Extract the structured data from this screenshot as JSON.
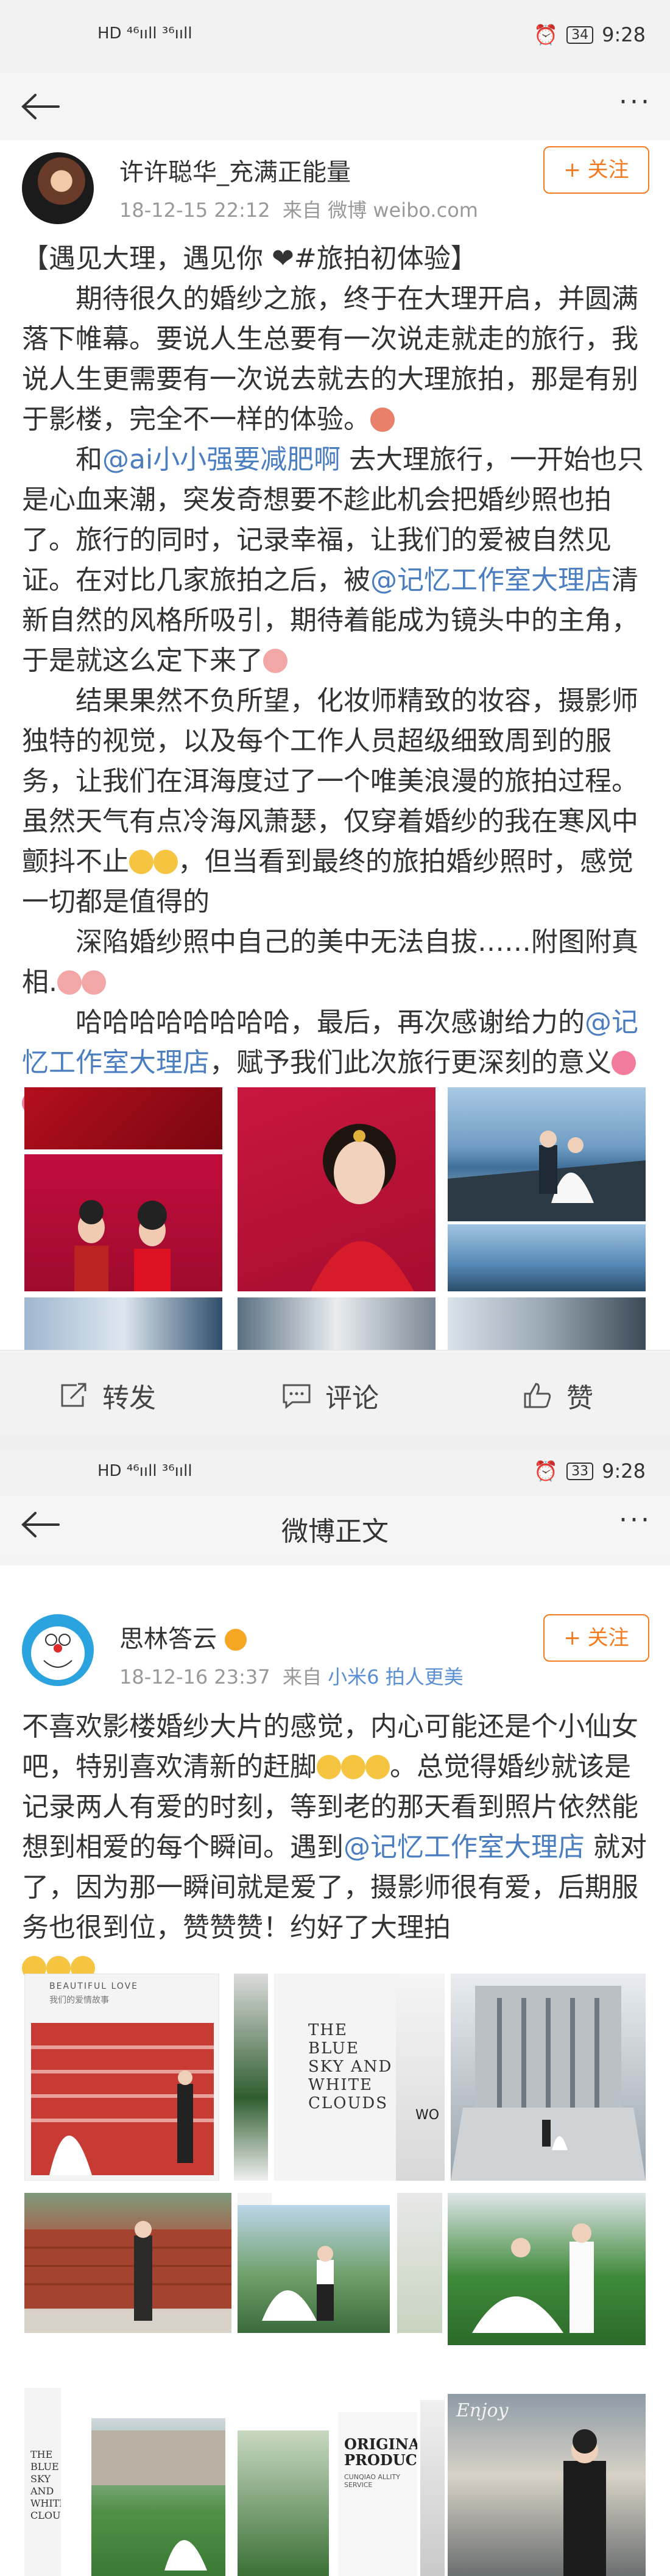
{
  "screen1": {
    "status": {
      "left": "HD ⁴⁶ııll ³⁶ııll",
      "battery": "34",
      "time": "9:28"
    },
    "nav": {
      "more": "···"
    },
    "post": {
      "username": "许许聪华_充满正能量",
      "time": "18-12-15 22:12",
      "source_prefix": "来自",
      "source": "微博 weibo.com",
      "follow_label": "+ 关注",
      "p1": "【遇见大理，遇见你 ❤#旅拍初体验】",
      "p2": "期待很久的婚纱之旅，终于在大理开启，并圆满落下帷幕。要说人生总要有一次说走就走的旅行，我说人生更需要有一次说去就去的大理旅拍，那是有别于影楼，完全不一样的体验。",
      "p3_a": "和",
      "p3_mention": "@ai小小强要减肥啊",
      "p3_b": " 去大理旅行，一开始也只是心血来潮，突发奇想要不趁此机会把婚纱照也拍了。旅行的同时，记录幸福，让我们的爱被自然见证。在对比几家旅拍之后，被",
      "p3_mention2": "@记忆工作室大理店",
      "p3_c": "清新自然的风格所吸引，期待着能成为镜头中的主角，于是就这么定下来了",
      "p4": "结果果然不负所望，化妆师精致的妆容，摄影师独特的视觉，以及每个工作人员超级细致周到的服务，让我们在洱海度过了一个唯美浪漫的旅拍过程。虽然天气有点冷海风萧瑟，仅穿着婚纱的我在寒风中颤抖不止",
      "p4_b": "，但当看到最终的旅拍婚纱照时，感觉一切都是值得的",
      "p5": "深陷婚纱照中自己的美中无法自拔……附图附真相.",
      "p6_a": "哈哈哈哈哈哈哈哈，最后，再次感谢给力的",
      "p6_mention": "@记忆工作室大理店",
      "p6_b": "，赋予我们此次旅行更深刻的意义"
    },
    "actions": {
      "repost": "转发",
      "comment": "评论",
      "like": "赞"
    }
  },
  "screen2": {
    "status": {
      "left": "HD ⁴⁶ııll ³⁶ııll",
      "battery": "33",
      "time": "9:28"
    },
    "nav": {
      "title": "微博正文",
      "more": "···"
    },
    "post": {
      "username": "思林答云",
      "time": "18-12-16 23:37",
      "source_prefix": "来自",
      "source": "小米6 拍人更美",
      "follow_label": "+ 关注",
      "text_a": "不喜欢影楼婚纱大片的感觉，内心可能还是个小仙女吧，特别喜欢清新的赶脚",
      "text_b": "。总觉得婚纱就该是记录两人有爱的时刻，等到老的那天看到照片依然能想到相爱的每个瞬间。遇到",
      "mention": "@记忆工作室大理店",
      "text_c": " 就对了，因为那一瞬间就是爱了，摄影师很有爱，后期服务也很到位，赞赞赞！约好了大理拍"
    },
    "album": {
      "t1_head": "BEAUTIFUL  LOVE",
      "t1_sub": "我们的爱情故事",
      "t2": "THE BLUE SKY AND WHITE CLOUDS",
      "t3": "WO",
      "t4": "THE BLUE SKY AND WHITE CLOUDS",
      "t5": "ORIGINAL PRODUCT",
      "t5_sub": "CUNQIAO ALLITY SERVICE",
      "t6": "Enjoy"
    }
  },
  "colors": {
    "accent": "#f47b20",
    "link": "#4a7ec0",
    "meta": "#999999"
  }
}
